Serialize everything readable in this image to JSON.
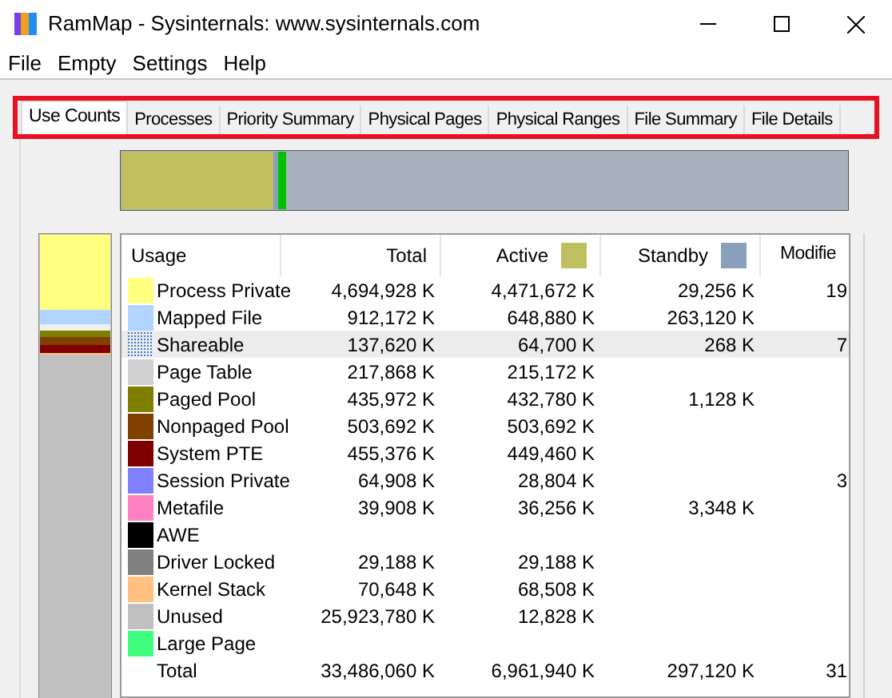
{
  "window": {
    "title": "RamMap - Sysinternals: www.sysinternals.com"
  },
  "menu": [
    "File",
    "Empty",
    "Settings",
    "Help"
  ],
  "tabs": [
    {
      "label": "Use Counts",
      "selected": true
    },
    {
      "label": "Processes",
      "selected": false
    },
    {
      "label": "Priority Summary",
      "selected": false
    },
    {
      "label": "Physical Pages",
      "selected": false
    },
    {
      "label": "Physical Ranges",
      "selected": false
    },
    {
      "label": "File Summary",
      "selected": false
    },
    {
      "label": "File Details",
      "selected": false
    }
  ],
  "table": {
    "columns": [
      {
        "label": "Usage"
      },
      {
        "label": "Total"
      },
      {
        "label": "Active",
        "color": "#c0bf60"
      },
      {
        "label": "Standby",
        "color": "#88a0bc"
      },
      {
        "label": "Modifie"
      }
    ],
    "rows": [
      {
        "kind": "swatch",
        "color": "#ffff80",
        "usage": "Process Private",
        "total": "4,694,928 K",
        "active": "4,471,672 K",
        "standby": "29,256 K",
        "modified": "19",
        "selected": false
      },
      {
        "kind": "swatch",
        "color": "#b0d4ff",
        "usage": "Mapped File",
        "total": "912,172 K",
        "active": "648,880 K",
        "standby": "263,120 K",
        "modified": "",
        "selected": false
      },
      {
        "kind": "dotted",
        "color": "#3a7be0",
        "usage": "Shareable",
        "total": "137,620 K",
        "active": "64,700 K",
        "standby": "268 K",
        "modified": "7",
        "selected": true
      },
      {
        "kind": "swatch",
        "color": "#d0d0d0",
        "usage": "Page Table",
        "total": "217,868 K",
        "active": "215,172 K",
        "standby": "",
        "modified": "",
        "selected": false
      },
      {
        "kind": "swatch",
        "color": "#808000",
        "usage": "Paged Pool",
        "total": "435,972 K",
        "active": "432,780 K",
        "standby": "1,128 K",
        "modified": "",
        "selected": false
      },
      {
        "kind": "swatch",
        "color": "#804000",
        "usage": "Nonpaged Pool",
        "total": "503,692 K",
        "active": "503,692 K",
        "standby": "",
        "modified": "",
        "selected": false
      },
      {
        "kind": "swatch",
        "color": "#800000",
        "usage": "System PTE",
        "total": "455,376 K",
        "active": "449,460 K",
        "standby": "",
        "modified": "",
        "selected": false
      },
      {
        "kind": "swatch",
        "color": "#8080ff",
        "usage": "Session Private",
        "total": "64,908 K",
        "active": "28,804 K",
        "standby": "",
        "modified": "3",
        "selected": false
      },
      {
        "kind": "swatch",
        "color": "#ff80c0",
        "usage": "Metafile",
        "total": "39,908 K",
        "active": "36,256 K",
        "standby": "3,348 K",
        "modified": "",
        "selected": false
      },
      {
        "kind": "swatch",
        "color": "#000000",
        "usage": "AWE",
        "total": "",
        "active": "",
        "standby": "",
        "modified": "",
        "selected": false
      },
      {
        "kind": "swatch",
        "color": "#808080",
        "usage": "Driver Locked",
        "total": "29,188 K",
        "active": "29,188 K",
        "standby": "",
        "modified": "",
        "selected": false
      },
      {
        "kind": "swatch",
        "color": "#ffc080",
        "usage": "Kernel Stack",
        "total": "70,648 K",
        "active": "68,508 K",
        "standby": "",
        "modified": "",
        "selected": false
      },
      {
        "kind": "swatch",
        "color": "#c0c0c0",
        "usage": "Unused",
        "total": "25,923,780 K",
        "active": "12,828 K",
        "standby": "",
        "modified": "",
        "selected": false
      },
      {
        "kind": "swatch",
        "color": "#40ff80",
        "usage": "Large Page",
        "total": "",
        "active": "",
        "standby": "",
        "modified": "",
        "selected": false
      },
      {
        "kind": "total",
        "usage": "Total",
        "total": "33,486,060 K",
        "active": "6,961,940 K",
        "standby": "297,120 K",
        "modified": "31",
        "selected": false
      }
    ]
  }
}
